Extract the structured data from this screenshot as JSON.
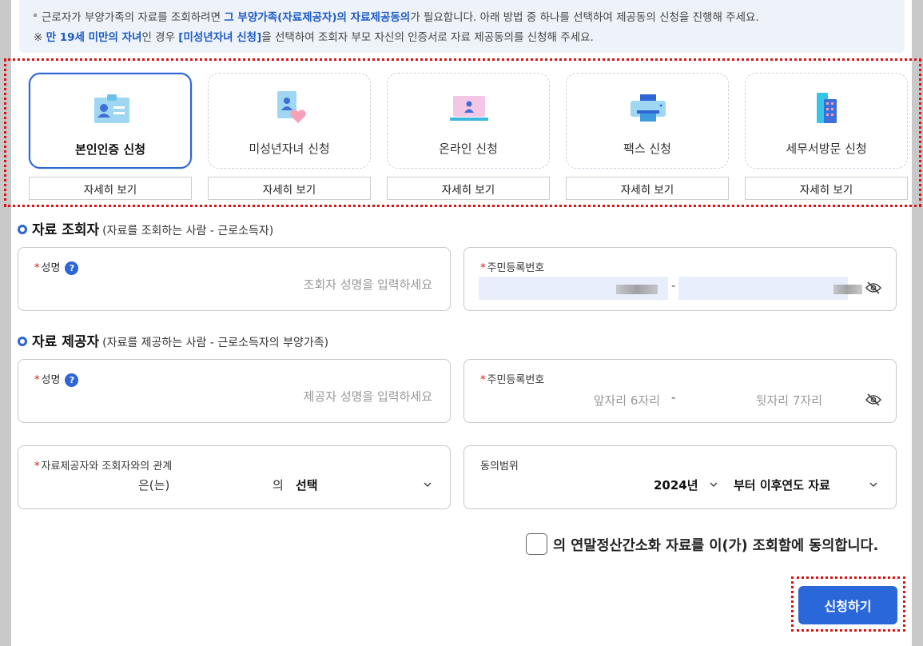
{
  "notice": {
    "line1_a": "근로자가 부양가족의 자료를 조회하려면 ",
    "line1_b": "그 부양가족(자료제공자)의 자료제공동의",
    "line1_c": "가 필요합니다. 아래 방법 중 하나를 선택하여 제공동의 신청을 진행해 주세요.",
    "line2_a": "※ ",
    "line2_b": "만 19세 미만의 자녀",
    "line2_c": "인 경우 ",
    "line2_d": "[미성년자녀 신청]",
    "line2_e": "을 선택하여 조회자 부모 자신의 인증서로 자료 제공동의를 신청해 주세요."
  },
  "methods": [
    {
      "label": "본인인증 신청",
      "icon": "id-card-icon",
      "active": true
    },
    {
      "label": "미성년자녀 신청",
      "icon": "minor-child-icon",
      "active": false
    },
    {
      "label": "온라인 신청",
      "icon": "laptop-icon",
      "active": false
    },
    {
      "label": "팩스 신청",
      "icon": "fax-icon",
      "active": false
    },
    {
      "label": "세무서방문 신청",
      "icon": "building-icon",
      "active": false
    }
  ],
  "detail_label": "자세히 보기",
  "requester": {
    "title": "자료 조회자",
    "subtitle": "(자료를 조회하는 사람 - 근로소득자)",
    "name_label": "성명",
    "name_placeholder": "조회자 성명을 입력하세요",
    "rrn_label": "주민등록번호"
  },
  "provider": {
    "title": "자료 제공자",
    "subtitle": "(자료를 제공하는 사람 - 근로소득자의 부양가족)",
    "name_label": "성명",
    "name_placeholder": "제공자 성명을 입력하세요",
    "rrn_label": "주민등록번호",
    "rrn_front_placeholder": "앞자리 6자리",
    "rrn_back_placeholder": "뒷자리 7자리"
  },
  "rrn_dash": "-",
  "help_mark": "?",
  "relation": {
    "label": "자료제공자와 조회자와의 관계",
    "part1": "은(는)",
    "part2": "의",
    "select_value": "선택"
  },
  "consent_scope": {
    "label": "동의범위",
    "year": "2024년",
    "scope": "부터 이후연도 자료"
  },
  "agreement_text": "의 연말정산간소화 자료를 이(가) 조회함에 동의합니다.",
  "submit_label": "신청하기",
  "colors": {
    "primary": "#2a67d9",
    "highlight_box": "#dd1111",
    "notice_bg": "#eef3fa"
  }
}
